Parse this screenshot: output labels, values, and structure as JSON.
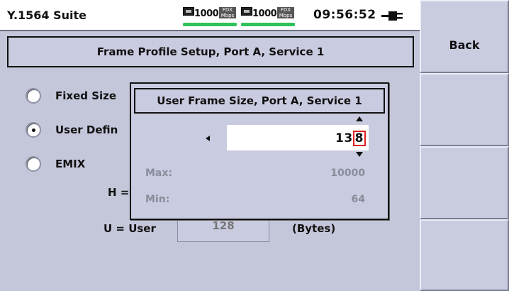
{
  "status_bar": {
    "app_title": "Y.1564 Suite",
    "link1": {
      "speed": "1000",
      "duplex_top": "FDX",
      "duplex_bottom": "Mbps"
    },
    "link2": {
      "speed": "1000",
      "duplex_top": "FDX",
      "duplex_bottom": "Mbps"
    },
    "clock": "09:56:52",
    "power_icon": "plug-icon",
    "link_bar_color": "#2ec25a"
  },
  "header": {
    "title": "Frame Profile Setup, Port A, Service 1"
  },
  "options": [
    {
      "label": "Fixed Size",
      "selected": false
    },
    {
      "label": "User Defin",
      "selected": true
    },
    {
      "label": "EMIX",
      "selected": false
    }
  ],
  "emix": {
    "h_label": "H =",
    "u_label": "U = User",
    "u_value": "128",
    "units": "(Bytes)"
  },
  "dialog": {
    "title": "User Frame Size, Port A, Service 1",
    "value_prefix": "13",
    "value_cursor_digit": "8",
    "max_label": "Max:",
    "max_value": "10000",
    "min_label": "Min:",
    "min_value": "64",
    "cursor_color": "#e02020"
  },
  "softkeys": {
    "back": "Back",
    "key2": "",
    "key3": "",
    "key4": ""
  }
}
